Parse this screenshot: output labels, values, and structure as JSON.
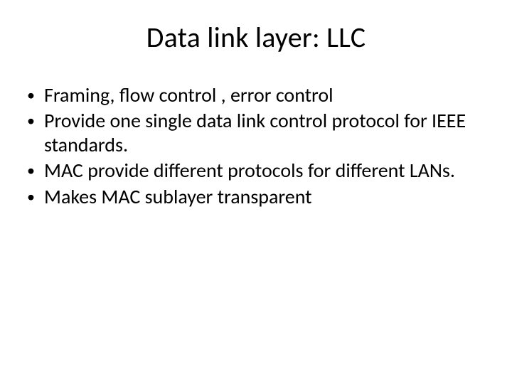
{
  "slide": {
    "title": "Data link layer: LLC",
    "bullets": [
      "Framing, flow control , error control",
      "Provide one single data link control protocol for IEEE standards.",
      "MAC provide different protocols for different LANs.",
      "Makes MAC sublayer transparent"
    ]
  }
}
